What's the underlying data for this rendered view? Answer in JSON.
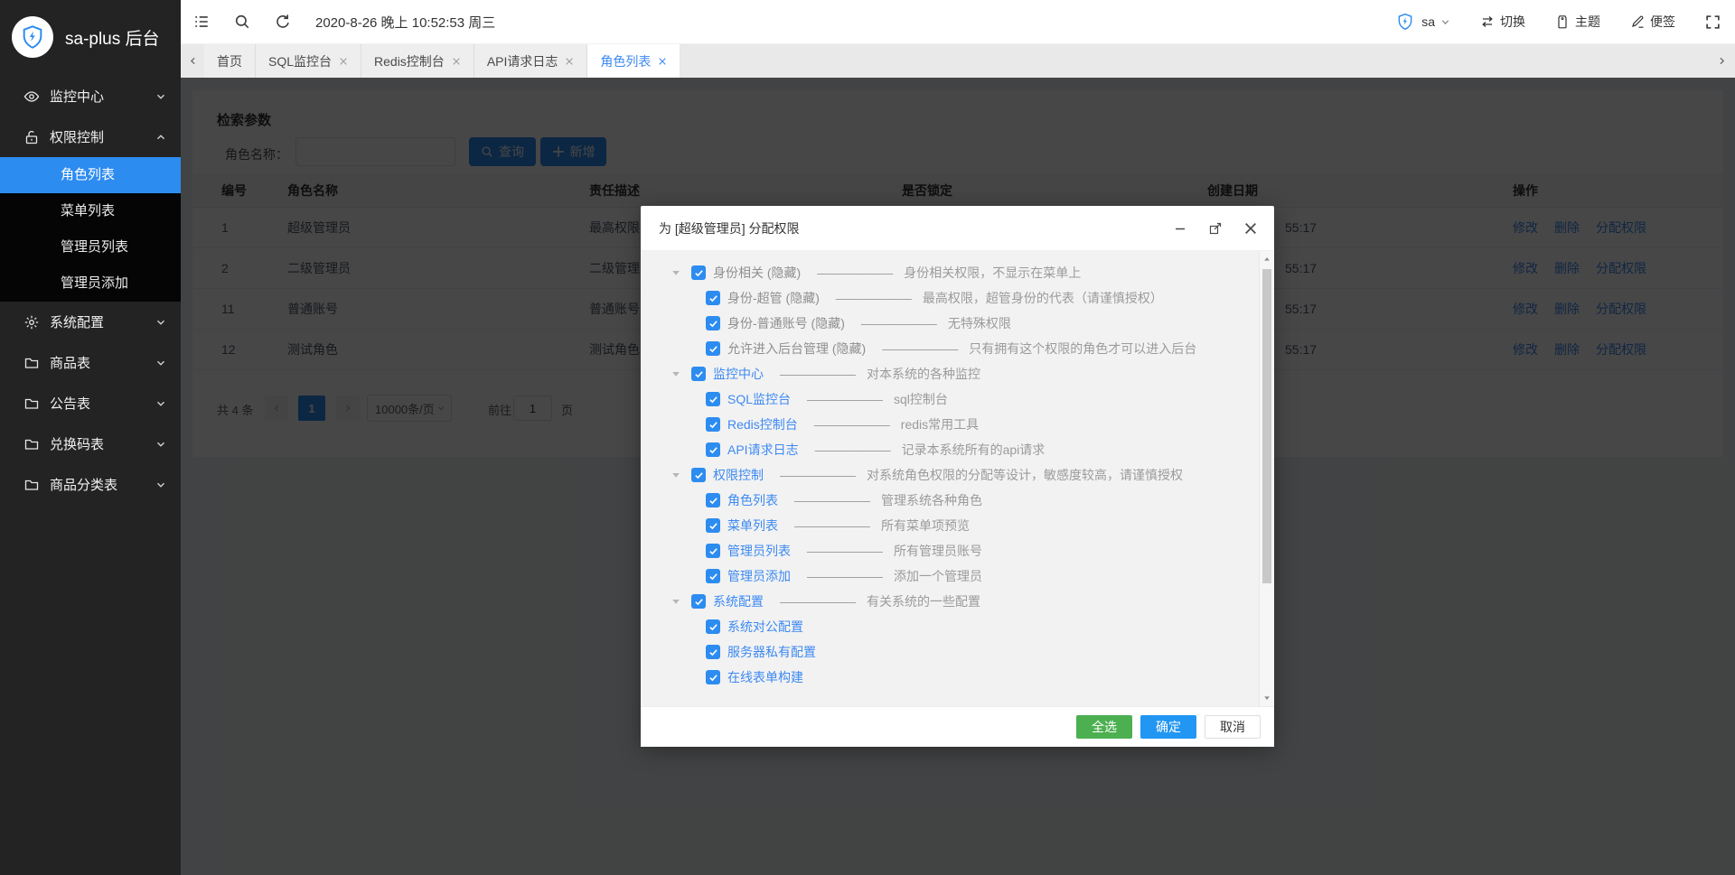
{
  "app": {
    "logo_title": "sa-plus 后台",
    "logo_icon": "shield-icon"
  },
  "topbar": {
    "left_icons": [
      "menu-icon",
      "search-icon",
      "refresh-icon"
    ],
    "datetime": "2020-8-26 晚上 10:52:53 周三",
    "user": {
      "icon": "shield-icon",
      "name": "sa"
    },
    "actions": [
      {
        "icon": "swap-icon",
        "label": "切换"
      },
      {
        "icon": "tag-icon",
        "label": "主题"
      },
      {
        "icon": "pen-icon",
        "label": "便签"
      }
    ],
    "fullscreen_icon": "fullscreen-icon"
  },
  "tabbar": {
    "tabs": [
      {
        "label": "首页",
        "closable": false,
        "active": false
      },
      {
        "label": "SQL监控台",
        "closable": true,
        "active": false
      },
      {
        "label": "Redis控制台",
        "closable": true,
        "active": false
      },
      {
        "label": "API请求日志",
        "closable": true,
        "active": false
      },
      {
        "label": "角色列表",
        "closable": true,
        "active": true
      }
    ]
  },
  "sidebar": {
    "items": [
      {
        "icon": "eye-icon",
        "label": "监控中心",
        "expanded": false,
        "children": []
      },
      {
        "icon": "lock-icon",
        "label": "权限控制",
        "expanded": true,
        "children": [
          {
            "label": "角色列表",
            "active": true
          },
          {
            "label": "菜单列表",
            "active": false
          },
          {
            "label": "管理员列表",
            "active": false
          },
          {
            "label": "管理员添加",
            "active": false
          }
        ]
      },
      {
        "icon": "gear-icon",
        "label": "系统配置",
        "expanded": false,
        "children": []
      },
      {
        "icon": "folder-icon",
        "label": "商品表",
        "expanded": false,
        "children": []
      },
      {
        "icon": "folder-icon",
        "label": "公告表",
        "expanded": false,
        "children": []
      },
      {
        "icon": "folder-icon",
        "label": "兑换码表",
        "expanded": false,
        "children": []
      },
      {
        "icon": "folder-icon",
        "label": "商品分类表",
        "expanded": false,
        "children": []
      }
    ]
  },
  "panel": {
    "title": "检索参数",
    "role_name_label": "角色名称：",
    "input_value": "",
    "search_button": {
      "icon": "search-icon",
      "label": "查询"
    },
    "add_button": {
      "icon": "plus-icon",
      "label": "新增"
    }
  },
  "table": {
    "headers": [
      "编号",
      "角色名称",
      "责任描述",
      "是否锁定",
      "创建日期",
      "操作"
    ],
    "action_labels": [
      "修改",
      "删除",
      "分配权限"
    ],
    "rows": [
      {
        "id": "1",
        "name": "超级管理员",
        "desc": "最高权限",
        "lock": "",
        "date_visible": "55:17"
      },
      {
        "id": "2",
        "name": "二级管理员",
        "desc": "二级管理员",
        "lock": "",
        "date_visible": "55:17"
      },
      {
        "id": "11",
        "name": "普通账号",
        "desc": "普通账号",
        "lock": "",
        "date_visible": "55:17"
      },
      {
        "id": "12",
        "name": "测试角色",
        "desc": "测试角色",
        "lock": "",
        "date_visible": "55:17"
      }
    ]
  },
  "pagination": {
    "total": "共 4 条",
    "page": "1",
    "page_size": "10000条/页",
    "goto_label": "前往",
    "goto_value": "1",
    "goto_unit": "页"
  },
  "modal": {
    "title": "为 [超级管理员] 分配权限",
    "controls": [
      "minimize-icon",
      "maximize-icon",
      "close-icon"
    ],
    "separator": "——————",
    "tree": [
      {
        "label": "身份相关 (隐藏)",
        "muted": true,
        "desc": "身份相关权限，不显示在菜单上",
        "children": [
          {
            "label": "身份-超管 (隐藏)",
            "muted": true,
            "desc": "最高权限，超管身份的代表（请谨慎授权）"
          },
          {
            "label": "身份-普通账号 (隐藏)",
            "muted": true,
            "desc": "无特殊权限"
          },
          {
            "label": "允许进入后台管理 (隐藏)",
            "muted": true,
            "desc": "只有拥有这个权限的角色才可以进入后台"
          }
        ]
      },
      {
        "label": "监控中心",
        "muted": false,
        "desc": "对本系统的各种监控",
        "children": [
          {
            "label": "SQL监控台",
            "muted": false,
            "desc": "sql控制台"
          },
          {
            "label": "Redis控制台",
            "muted": false,
            "desc": "redis常用工具"
          },
          {
            "label": "API请求日志",
            "muted": false,
            "desc": "记录本系统所有的api请求"
          }
        ]
      },
      {
        "label": "权限控制",
        "muted": false,
        "desc": "对系统角色权限的分配等设计，敏感度较高，请谨慎授权",
        "children": [
          {
            "label": "角色列表",
            "muted": false,
            "desc": "管理系统各种角色"
          },
          {
            "label": "菜单列表",
            "muted": false,
            "desc": "所有菜单项预览"
          },
          {
            "label": "管理员列表",
            "muted": false,
            "desc": "所有管理员账号"
          },
          {
            "label": "管理员添加",
            "muted": false,
            "desc": "添加一个管理员"
          }
        ]
      },
      {
        "label": "系统配置",
        "muted": false,
        "desc": "有关系统的一些配置",
        "children": [
          {
            "label": "系统对公配置",
            "muted": false,
            "desc": ""
          },
          {
            "label": "服务器私有配置",
            "muted": false,
            "desc": ""
          },
          {
            "label": "在线表单构建",
            "muted": false,
            "desc": ""
          }
        ]
      }
    ],
    "footer": [
      {
        "label": "全选",
        "style": "green"
      },
      {
        "label": "确定",
        "style": "primary"
      },
      {
        "label": "取消",
        "style": "plain"
      }
    ]
  },
  "colors": {
    "accent_blue": "#2d8cf0",
    "link_blue": "#3d8af2",
    "button_green": "#4caf50",
    "confirm_blue": "#2196f3",
    "sidebar_bg": "#232323",
    "submenu_bg": "#050505"
  }
}
